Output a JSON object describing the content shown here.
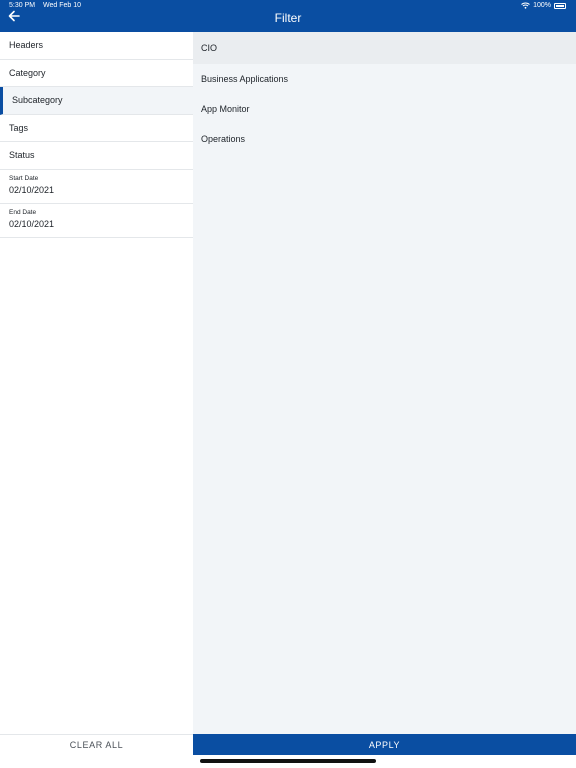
{
  "status_bar": {
    "time": "5:30 PM",
    "date": "Wed Feb 10",
    "battery": "100%"
  },
  "header": {
    "title": "Filter",
    "back_icon": "arrow-left-icon"
  },
  "left_menu": {
    "items": [
      {
        "label": "Headers"
      },
      {
        "label": "Category"
      },
      {
        "label": "Subcategory",
        "active": true
      },
      {
        "label": "Tags"
      },
      {
        "label": "Status"
      }
    ],
    "start_date": {
      "label": "Start Date",
      "value": "02/10/2021"
    },
    "end_date": {
      "label": "End Date",
      "value": "02/10/2021"
    }
  },
  "options": [
    {
      "label": "CIO",
      "selected": true
    },
    {
      "label": "Business Applications"
    },
    {
      "label": "App Monitor"
    },
    {
      "label": "Operations"
    }
  ],
  "footer": {
    "clear_label": "CLEAR ALL",
    "apply_label": "APPLY"
  },
  "colors": {
    "brand": "#0a4ea2",
    "panel": "#f2f5f8"
  }
}
